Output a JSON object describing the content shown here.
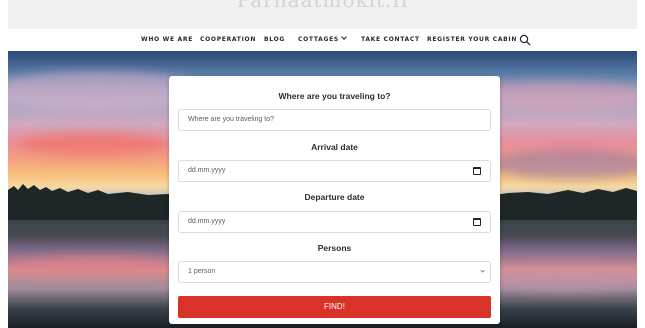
{
  "header": {
    "logo_text": "Parhaatmokit.fi"
  },
  "nav": {
    "items": [
      {
        "label": "WHO WE ARE"
      },
      {
        "label": "COOPERATION"
      },
      {
        "label": "BLOG"
      },
      {
        "label": "COTTAGES"
      },
      {
        "label": "TAKE CONTACT"
      },
      {
        "label": "REGISTER YOUR CABIN"
      }
    ],
    "search_icon": "search-icon",
    "dropdown_icon": "chevron-down-icon"
  },
  "form": {
    "destination_label": "Where are you traveling to?",
    "destination_placeholder": "Where are you traveling to?",
    "arrival_label": "Arrival date",
    "arrival_value": "dd.mm.yyyy",
    "departure_label": "Departure date",
    "departure_value": "dd.mm.yyyy",
    "persons_label": "Persons",
    "persons_value": "1 person",
    "submit_label": "FIND!",
    "calendar_icon": "calendar-icon"
  },
  "colors": {
    "accent": "#d93329",
    "nav_text": "#1f2630"
  }
}
